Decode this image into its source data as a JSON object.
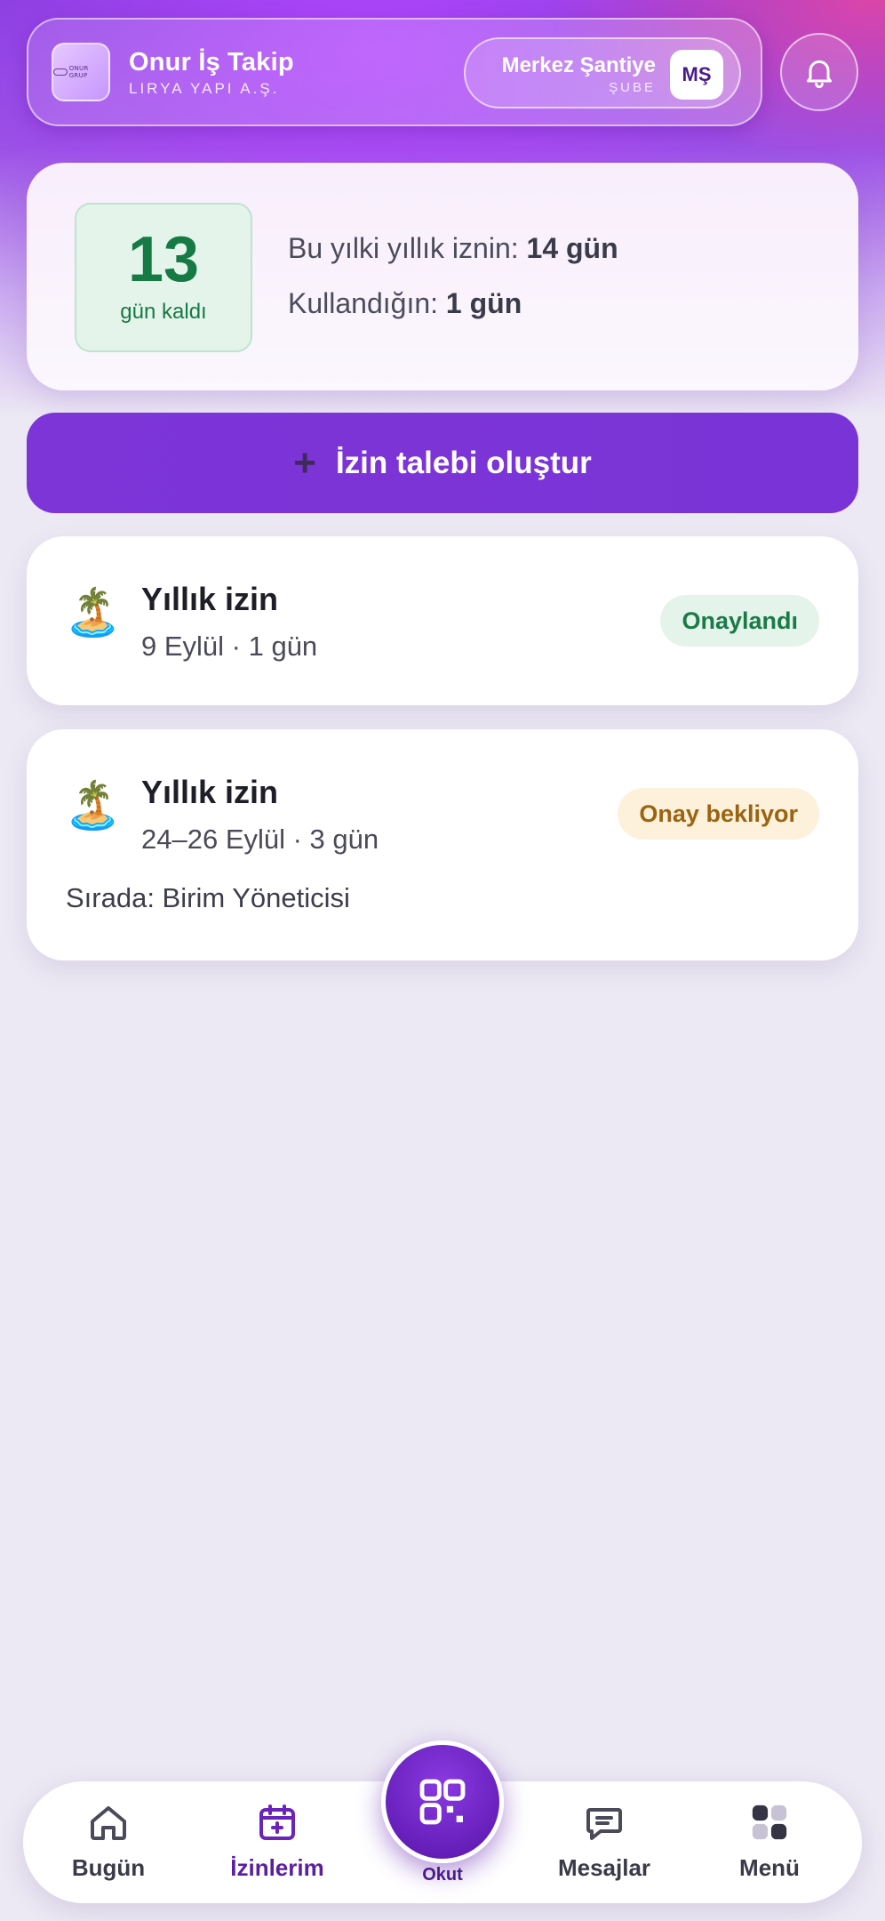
{
  "header": {
    "app_title": "Onur İş Takip",
    "company": "LIRYA YAPI A.Ş.",
    "logo_text": "ONUR GRUP",
    "branch_name": "Merkez Şantiye",
    "branch_label": "ŞUBE",
    "branch_initials": "MŞ",
    "notifications_icon": "bell-icon"
  },
  "summary": {
    "days_left": "13",
    "days_left_label": "gün kaldı",
    "annual_label": "Bu yılki yıllık iznin:",
    "annual_value": "14 gün",
    "used_label": "Kullandığın:",
    "used_value": "1 gün"
  },
  "create_button": {
    "icon": "plus-icon",
    "label": "İzin talebi oluştur"
  },
  "requests": [
    {
      "emoji": "🏝️",
      "type": "Yıllık izin",
      "meta": "9 Eylül · 1 gün",
      "status": "Onaylandı"
    },
    {
      "emoji": "🏝️",
      "type": "Yıllık izin",
      "meta": "24–26 Eylül · 3 gün",
      "status": "Onay bekliyor",
      "queue": "Sırada: Birim Yöneticisi"
    }
  ],
  "nav": {
    "items": [
      {
        "label": "Bugün",
        "icon": "home-icon"
      },
      {
        "label": "İzinlerim",
        "icon": "calendar-plus-icon",
        "active": true
      },
      {
        "label": "Okut",
        "icon": "qr-scan-icon"
      },
      {
        "label": "Mesajlar",
        "icon": "message-icon"
      },
      {
        "label": "Menü",
        "icon": "grid-menu-icon"
      }
    ]
  },
  "colors": {
    "accent": "#7a33d6",
    "approved": "#1a7a48",
    "pending": "#9a6410"
  }
}
